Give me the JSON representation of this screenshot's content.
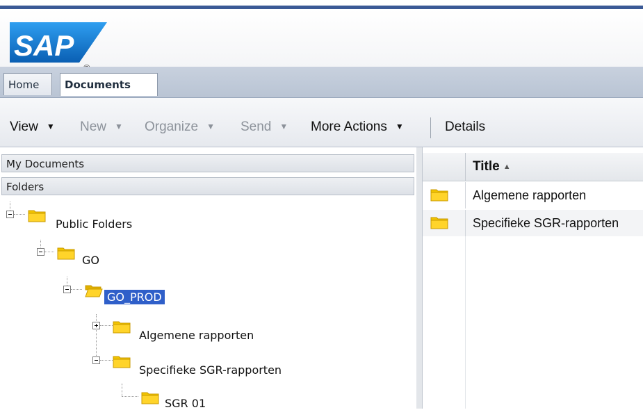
{
  "brand": {
    "logo_text": "SAP",
    "registered_mark": "®"
  },
  "tabs": [
    {
      "label": "Home",
      "active": false
    },
    {
      "label": "Documents",
      "active": true
    }
  ],
  "toolbar": {
    "view": "View",
    "new": "New",
    "organize": "Organize",
    "send": "Send",
    "more_actions": "More Actions",
    "details": "Details"
  },
  "left_pane": {
    "my_documents": "My Documents",
    "folders": "Folders",
    "tree": [
      {
        "label": "Public Folders",
        "level": 0,
        "expanded": true
      },
      {
        "label": "GO",
        "level": 1,
        "expanded": true
      },
      {
        "label": "GO_PROD",
        "level": 2,
        "expanded": true,
        "selected": true
      },
      {
        "label": "Algemene rapporten",
        "level": 3,
        "expanded": false
      },
      {
        "label": "Specifieke SGR-rapporten",
        "level": 3,
        "expanded": true
      },
      {
        "label": "SGR 01",
        "level": 4
      }
    ]
  },
  "right_pane": {
    "column_title": "Title",
    "rows": [
      {
        "title": "Algemene rapporten"
      },
      {
        "title": "Specifieke SGR-rapporten"
      }
    ]
  },
  "colors": {
    "selection": "#2f5fc9",
    "folder": "#f2c400",
    "brand_blue": "#1473c6"
  }
}
